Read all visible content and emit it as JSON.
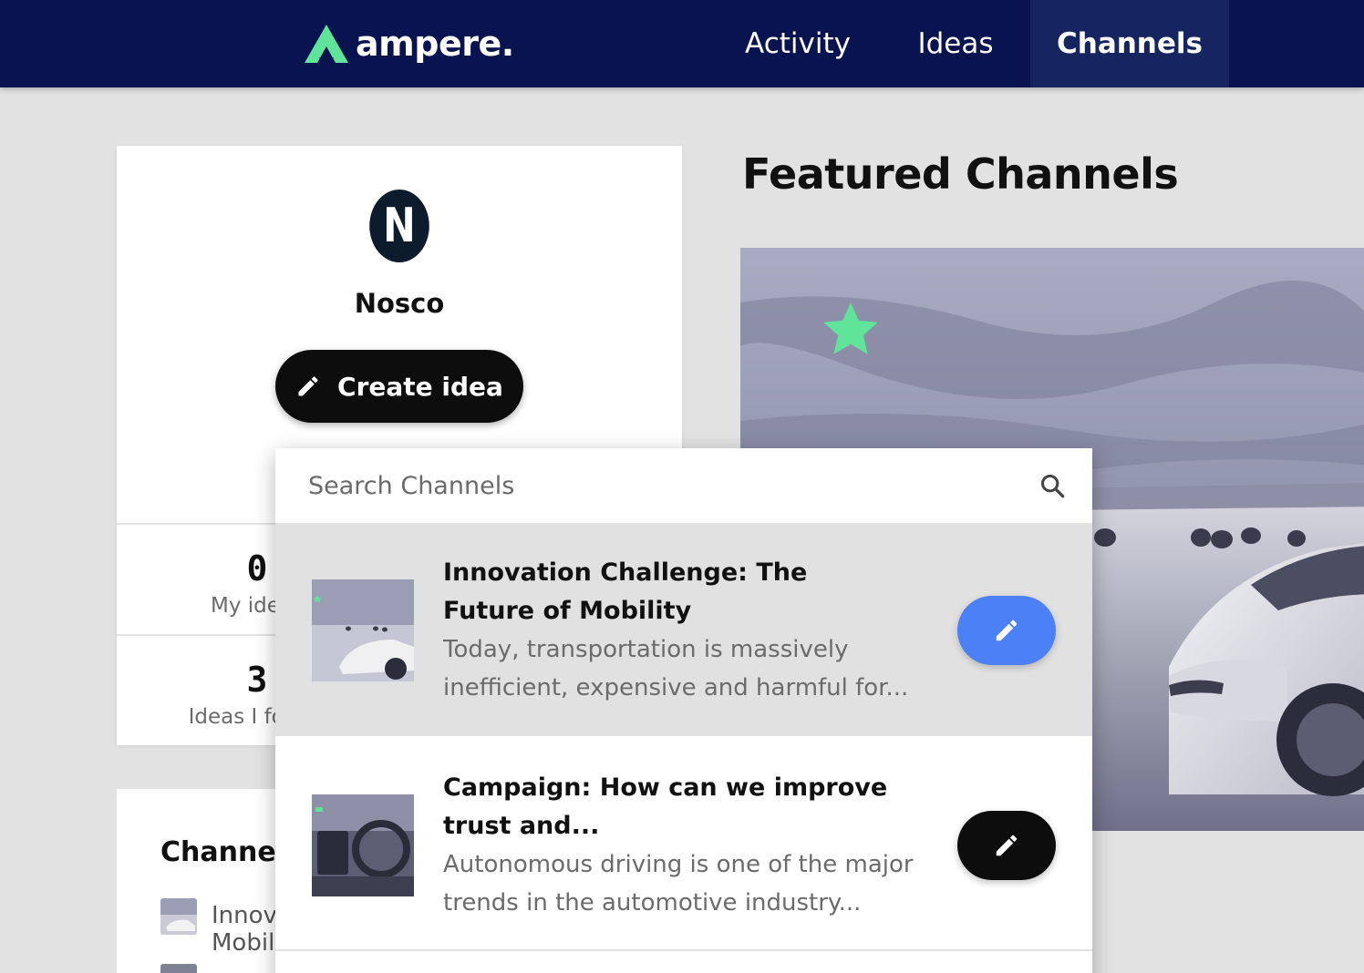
{
  "header": {
    "logo_text": "ampere.",
    "nav": [
      {
        "label": "Activity",
        "active": false
      },
      {
        "label": "Ideas",
        "active": false
      },
      {
        "label": "Channels",
        "active": true
      }
    ],
    "bg_color": "#09134f",
    "logo_accent": "#5fe49a"
  },
  "profile": {
    "avatar_letter": "N",
    "name": "Nosco",
    "create_label": "Create idea",
    "stats": [
      {
        "value": "0",
        "label": "My ideas"
      },
      {
        "value": "3",
        "label": "Ideas I follow"
      }
    ]
  },
  "channels_panel": {
    "title": "Channels",
    "items": [
      {
        "label": "Innovation Challenge: The Future of Mobility"
      }
    ]
  },
  "featured": {
    "title": "Featured Channels",
    "star_color": "#5fe49a"
  },
  "search": {
    "placeholder": "Search Channels",
    "results": [
      {
        "title": "Innovation Challenge: The Future of Mobility",
        "description": "Today, transportation is massively inefficient, expensive and harmful for...",
        "button_color": "#4c80f6",
        "highlighted": true
      },
      {
        "title": "Campaign: How can we improve trust and...",
        "description": "Autonomous driving is one of the major trends in the automotive industry...",
        "button_color": "#0d0d0d",
        "highlighted": false
      }
    ]
  }
}
